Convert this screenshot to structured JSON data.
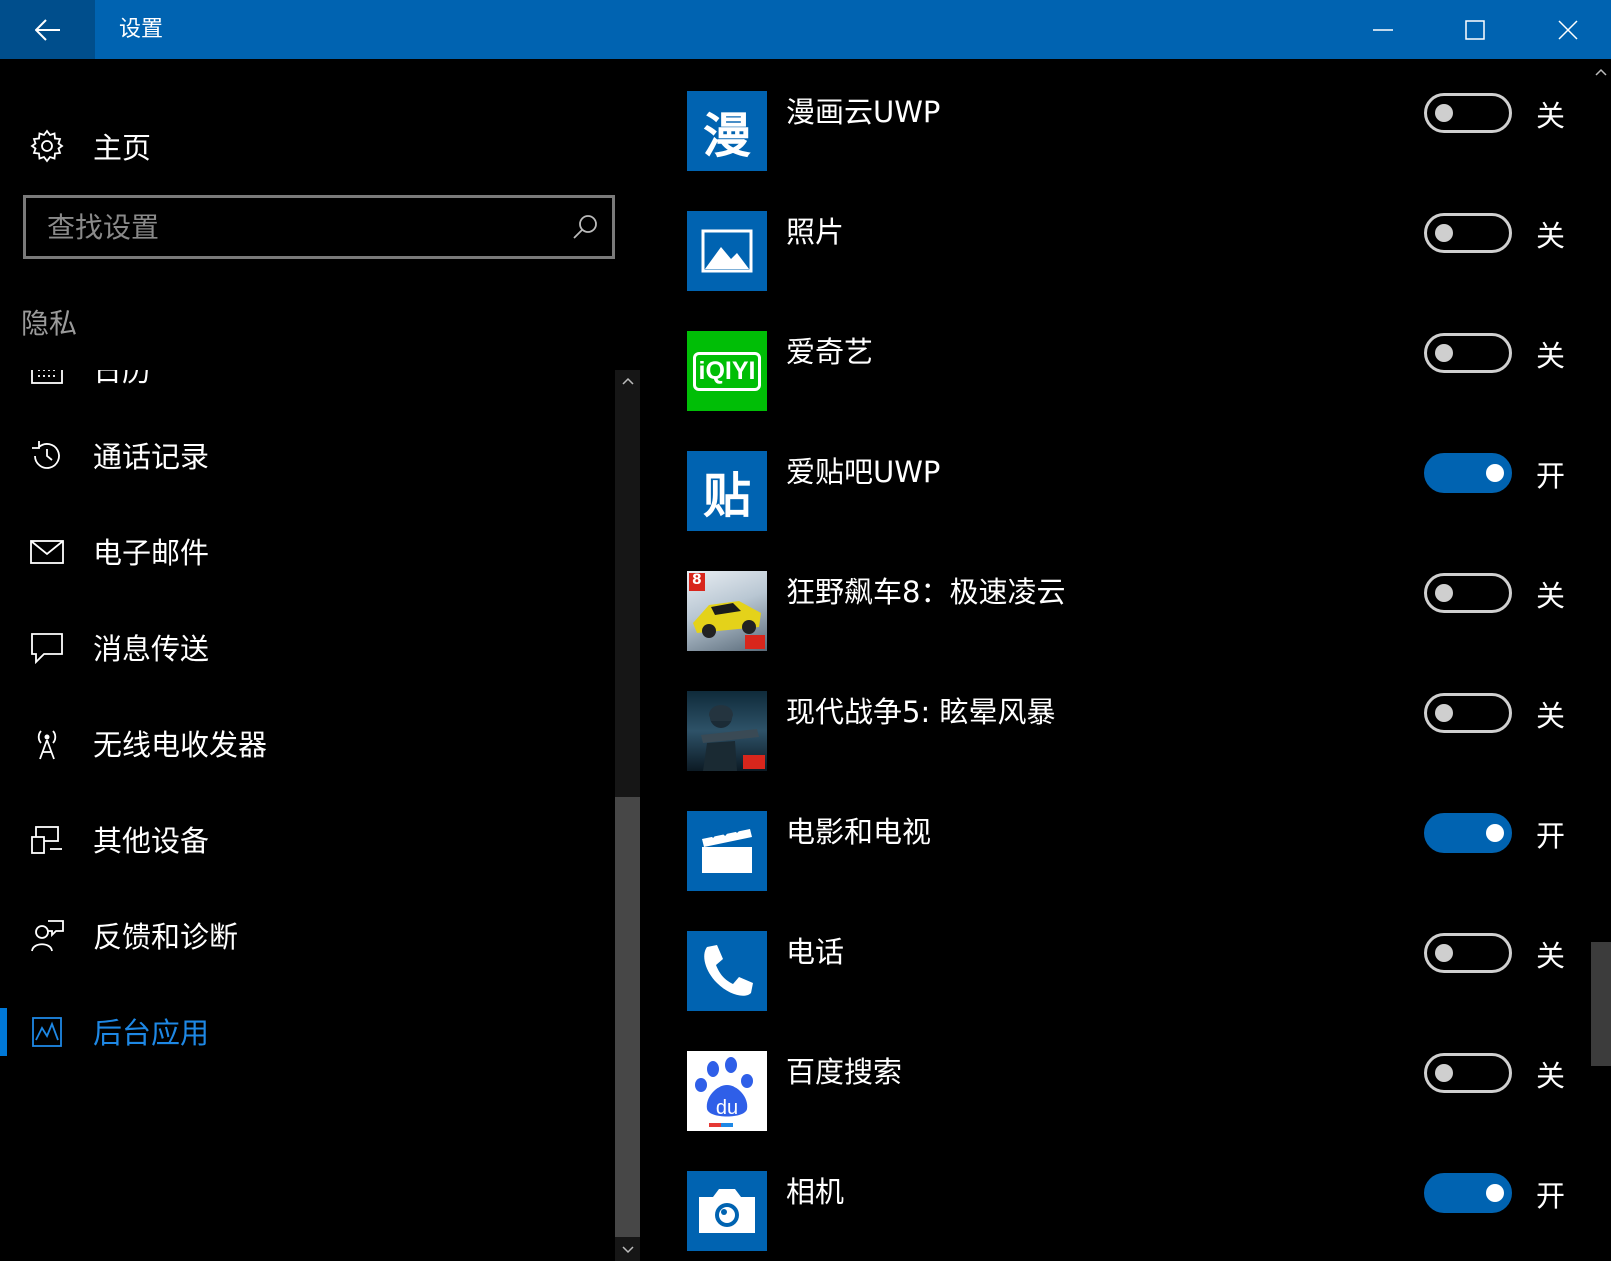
{
  "window": {
    "title": "设置",
    "accent_color": "#0063b1"
  },
  "sidebar": {
    "home_label": "主页",
    "search_placeholder": "查找设置",
    "section_heading": "隐私",
    "items": [
      {
        "label": "日历",
        "icon": "calendar-icon",
        "selected": false
      },
      {
        "label": "通话记录",
        "icon": "history-icon",
        "selected": false
      },
      {
        "label": "电子邮件",
        "icon": "mail-icon",
        "selected": false
      },
      {
        "label": "消息传送",
        "icon": "chat-icon",
        "selected": false
      },
      {
        "label": "无线电收发器",
        "icon": "antenna-icon",
        "selected": false
      },
      {
        "label": "其他设备",
        "icon": "devices-icon",
        "selected": false
      },
      {
        "label": "反馈和诊断",
        "icon": "feedback-icon",
        "selected": false
      },
      {
        "label": "后台应用",
        "icon": "background-apps-icon",
        "selected": true
      }
    ]
  },
  "apps": [
    {
      "name": "漫画云UWP",
      "icon": "manhuayun-icon",
      "on": false,
      "state": "关"
    },
    {
      "name": "照片",
      "icon": "photos-icon",
      "on": false,
      "state": "关"
    },
    {
      "name": "爱奇艺",
      "icon": "iqiyi-icon",
      "on": false,
      "state": "关"
    },
    {
      "name": "爱贴吧UWP",
      "icon": "tieba-icon",
      "on": true,
      "state": "开"
    },
    {
      "name": "狂野飙车8：极速凌云",
      "icon": "asphalt8-icon",
      "on": false,
      "state": "关"
    },
    {
      "name": "现代战争5: 眩晕风暴",
      "icon": "modern-combat5-icon",
      "on": false,
      "state": "关"
    },
    {
      "name": "电影和电视",
      "icon": "movies-tv-icon",
      "on": true,
      "state": "开"
    },
    {
      "name": "电话",
      "icon": "phone-icon",
      "on": false,
      "state": "关"
    },
    {
      "name": "百度搜索",
      "icon": "baidu-icon",
      "on": false,
      "state": "关"
    },
    {
      "name": "相机",
      "icon": "camera-icon",
      "on": true,
      "state": "开"
    }
  ],
  "app_tile_text": {
    "manhuayun": "漫",
    "tieba": "贴",
    "iqiyi": "iQIYI",
    "baidu": "du",
    "asphalt_badge": "8"
  }
}
